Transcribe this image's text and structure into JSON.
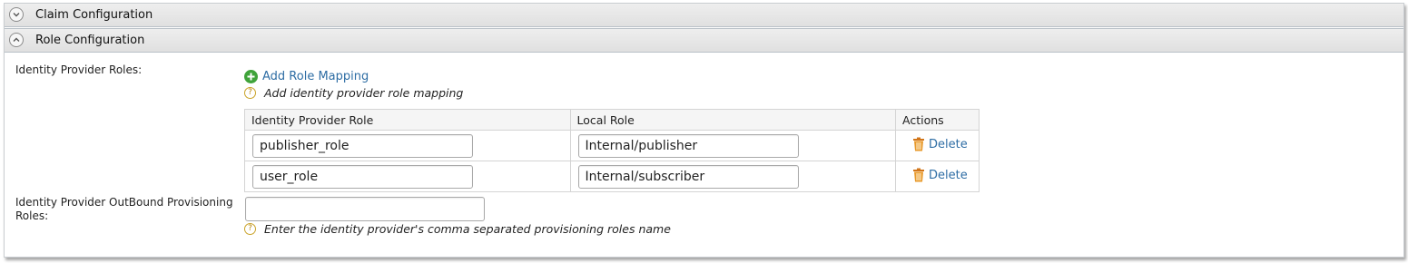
{
  "sections": {
    "claim": {
      "title": "Claim Configuration",
      "icon": "chevron-down-icon"
    },
    "role": {
      "title": "Role Configuration",
      "icon": "chevron-up-icon"
    }
  },
  "idp_roles": {
    "label": "Identity Provider Roles:",
    "add_link": "Add Role Mapping",
    "add_icon": "plus-circle-icon",
    "help_text": "Add identity provider role mapping",
    "table": {
      "headers": [
        "Identity Provider Role",
        "Local Role",
        "Actions"
      ],
      "rows": [
        {
          "idp_role": "publisher_role",
          "local_role": "Internal/publisher",
          "action": "Delete"
        },
        {
          "idp_role": "user_role",
          "local_role": "Internal/subscriber",
          "action": "Delete"
        }
      ]
    }
  },
  "outbound": {
    "label_line1": "Identity Provider OutBound Provisioning",
    "label_line2": "Roles:",
    "value": "",
    "help_text": "Enter the identity provider's comma separated provisioning roles name"
  },
  "colors": {
    "link": "#2e6da4",
    "add_icon": "#3fa33a",
    "delete_icon": "#e08a1e",
    "help_icon": "#c9a227"
  }
}
